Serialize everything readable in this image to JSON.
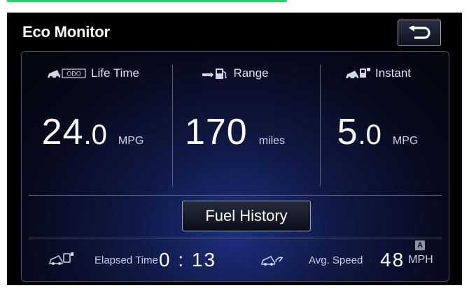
{
  "header": {
    "title": "Eco Monitor",
    "back_icon": "return-arrow-icon"
  },
  "metrics": [
    {
      "label": "Life Time",
      "icon": "odo-car-icon",
      "int": "24",
      "dec": ".0",
      "unit": "MPG"
    },
    {
      "label": "Range",
      "icon": "fuel-pump-icon",
      "int": "170",
      "dec": "",
      "unit": "miles"
    },
    {
      "label": "Instant",
      "icon": "car-fuel-icon",
      "int": "5",
      "dec": ".0",
      "unit": "MPG"
    }
  ],
  "fuel_history_button": "Fuel History",
  "footer": {
    "elapsed_label": "Elapsed Time",
    "elapsed_value": "0 : 13",
    "avg_speed_label": "Avg. Speed",
    "avg_speed_value": "48",
    "avg_speed_unit": "MPH",
    "avg_speed_badge": "A"
  },
  "colors": {
    "accent_line": "#2fd06a",
    "panel_glow": "#1e2f80"
  }
}
